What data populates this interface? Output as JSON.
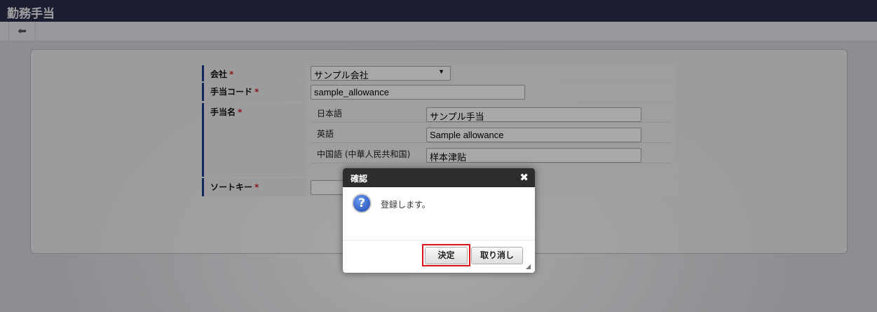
{
  "header": {
    "title": "勤務手当"
  },
  "toolbar": {
    "back_icon": "arrow-left-icon"
  },
  "form": {
    "company": {
      "label": "会社",
      "required": "*",
      "value": "サンプル会社"
    },
    "code": {
      "label": "手当コード",
      "required": "*",
      "value": "sample_allowance"
    },
    "name": {
      "label": "手当名",
      "required": "*",
      "locales": [
        {
          "label": "日本語",
          "value": "サンプル手当"
        },
        {
          "label": "英語",
          "value": "Sample allowance"
        },
        {
          "label": "中国語 (中華人民共和国)",
          "value": "样本津贴"
        }
      ]
    },
    "sort_key": {
      "label": "ソートキー",
      "required": "*",
      "value": ""
    }
  },
  "dialog": {
    "title": "確認",
    "close": "✖",
    "icon": "question-icon",
    "message": "登録します。",
    "ok": "決定",
    "cancel": "取り消し"
  }
}
